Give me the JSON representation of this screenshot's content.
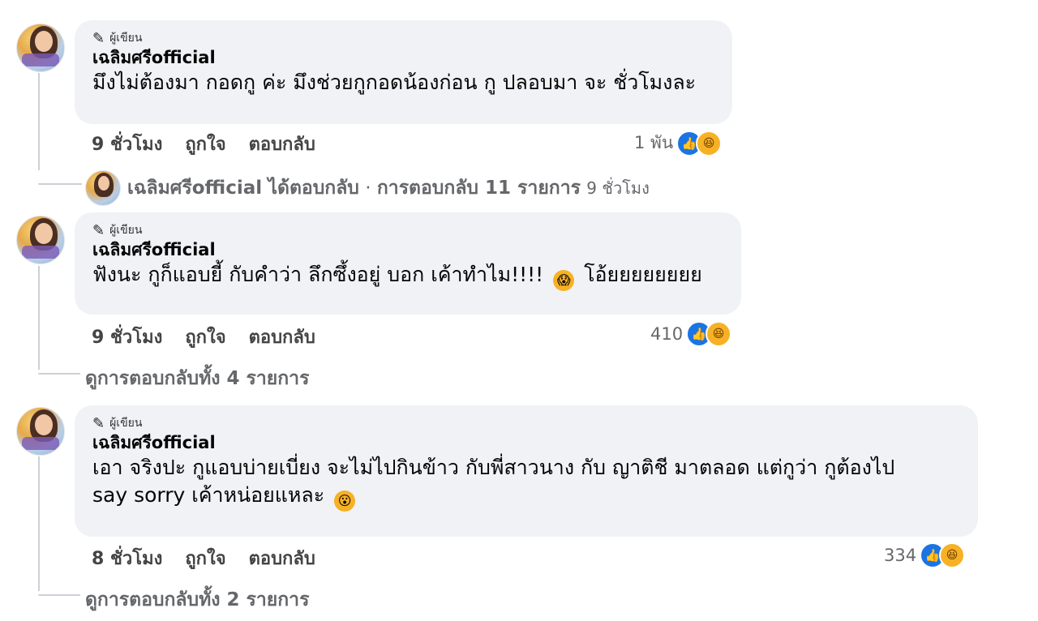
{
  "threads": [
    {
      "badge": "ผู้เขียน",
      "author": "เฉลิมศรีofficial",
      "text": "มึงไม่ต้องมา กอดกู ค่ะ มึงช่วยกูกอดน้องก่อน กู ปลอบมา จะ ชั่วโมงละ",
      "time": "9 ชั่วโมง",
      "like": "ถูกใจ",
      "reply": "ตอบกลับ",
      "reaction_count": "1 พัน",
      "replies_summary": {
        "author": "เฉลิมศรีofficial",
        "action": "ได้ตอบกลับ",
        "separator": "·",
        "count": "การตอบกลับ 11 รายการ",
        "time": "9 ชั่วโมง"
      }
    },
    {
      "badge": "ผู้เขียน",
      "author": "เฉลิมศรีofficial",
      "text_before": "ฟังนะ กูก็แอบยี้ กับคำว่า ลึกซึ้งอยู่ บอก เค้าทำไม!!!!",
      "text_after": "โอ้ยยยยยยยย",
      "time": "9 ชั่วโมง",
      "like": "ถูกใจ",
      "reply": "ตอบกลับ",
      "reaction_count": "410",
      "view_replies": "ดูการตอบกลับทั้ง 4 รายการ"
    },
    {
      "badge": "ผู้เขียน",
      "author": "เฉลิมศรีofficial",
      "text_line1": "เอา จริงปะ กูแอบบ่ายเบี่ยง จะไม่ไปกินข้าว กับพี่สาวนาง กับ ญาติชี มาตลอด แต่กูว่า กูต้องไป",
      "text_line2": "say sorry เค้าหน่อยแหละ",
      "time": "8 ชั่วโมง",
      "like": "ถูกใจ",
      "reply": "ตอบกลับ",
      "reaction_count": "334",
      "view_replies": "ดูการตอบกลับทั้ง 2 รายการ"
    }
  ],
  "icons": {
    "badge": "pen-icon",
    "like_reaction": "like-icon",
    "haha_reaction": "haha-icon"
  },
  "colors": {
    "bubble": "#f0f2f5",
    "like": "#1b74e4",
    "haha": "#f7b125",
    "meta_text": "#65676b"
  }
}
